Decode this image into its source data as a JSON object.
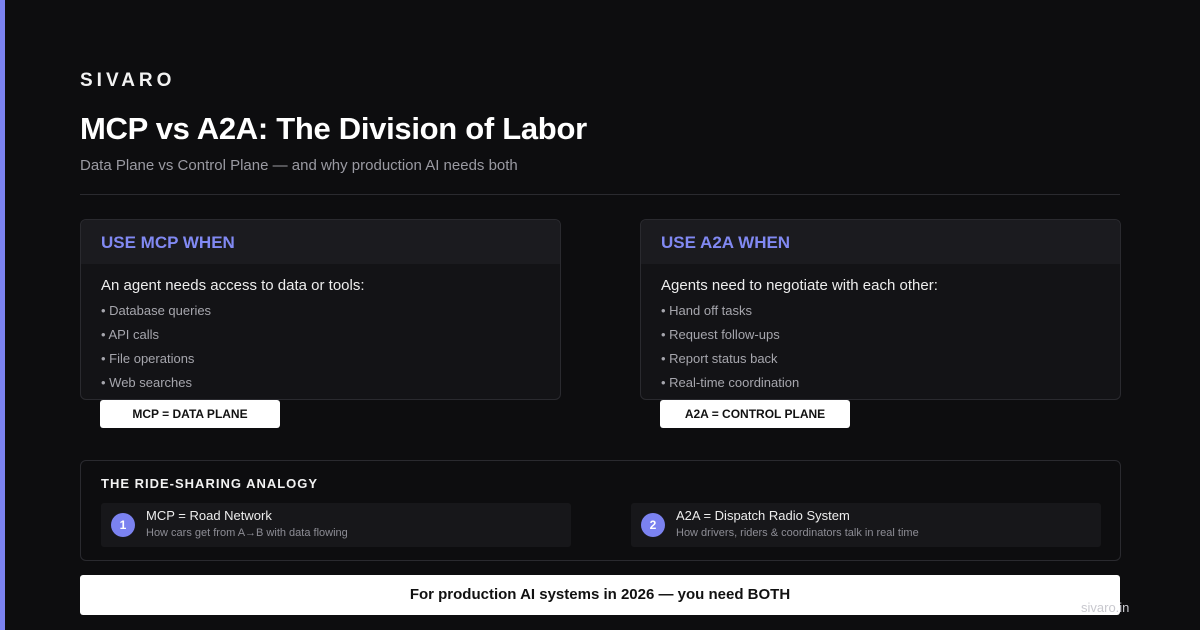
{
  "brand": "SIVARO",
  "header": {
    "title": "MCP vs A2A: The Division of Labor",
    "subtitle": "Data Plane vs Control Plane — and why production AI needs both"
  },
  "cards": [
    {
      "heading": "USE MCP WHEN",
      "lead": "An agent needs access to data or tools:",
      "items": [
        "• Database queries",
        "• API calls",
        "• File operations",
        "• Web searches"
      ],
      "badge": "MCP = DATA PLANE"
    },
    {
      "heading": "USE A2A WHEN",
      "lead": "Agents need to negotiate with each other:",
      "items": [
        "• Hand off tasks",
        "• Request follow-ups",
        "• Report status back",
        "• Real-time coordination"
      ],
      "badge": "A2A = CONTROL PLANE"
    }
  ],
  "analogy": {
    "title": "THE RIDE-SHARING ANALOGY",
    "items": [
      {
        "num": "1",
        "head": "MCP = Road Network",
        "sub": "How cars get from A→B with data flowing"
      },
      {
        "num": "2",
        "head": "A2A = Dispatch Radio System",
        "sub": "How drivers, riders & coordinators talk in real time"
      }
    ]
  },
  "banner": "For production AI systems in 2026 — you need BOTH",
  "footer": {
    "url": "sivaro.in"
  },
  "colors": {
    "accent": "#7b82f0",
    "background": "#0d0d0f",
    "card_heading": "#8189f2"
  }
}
